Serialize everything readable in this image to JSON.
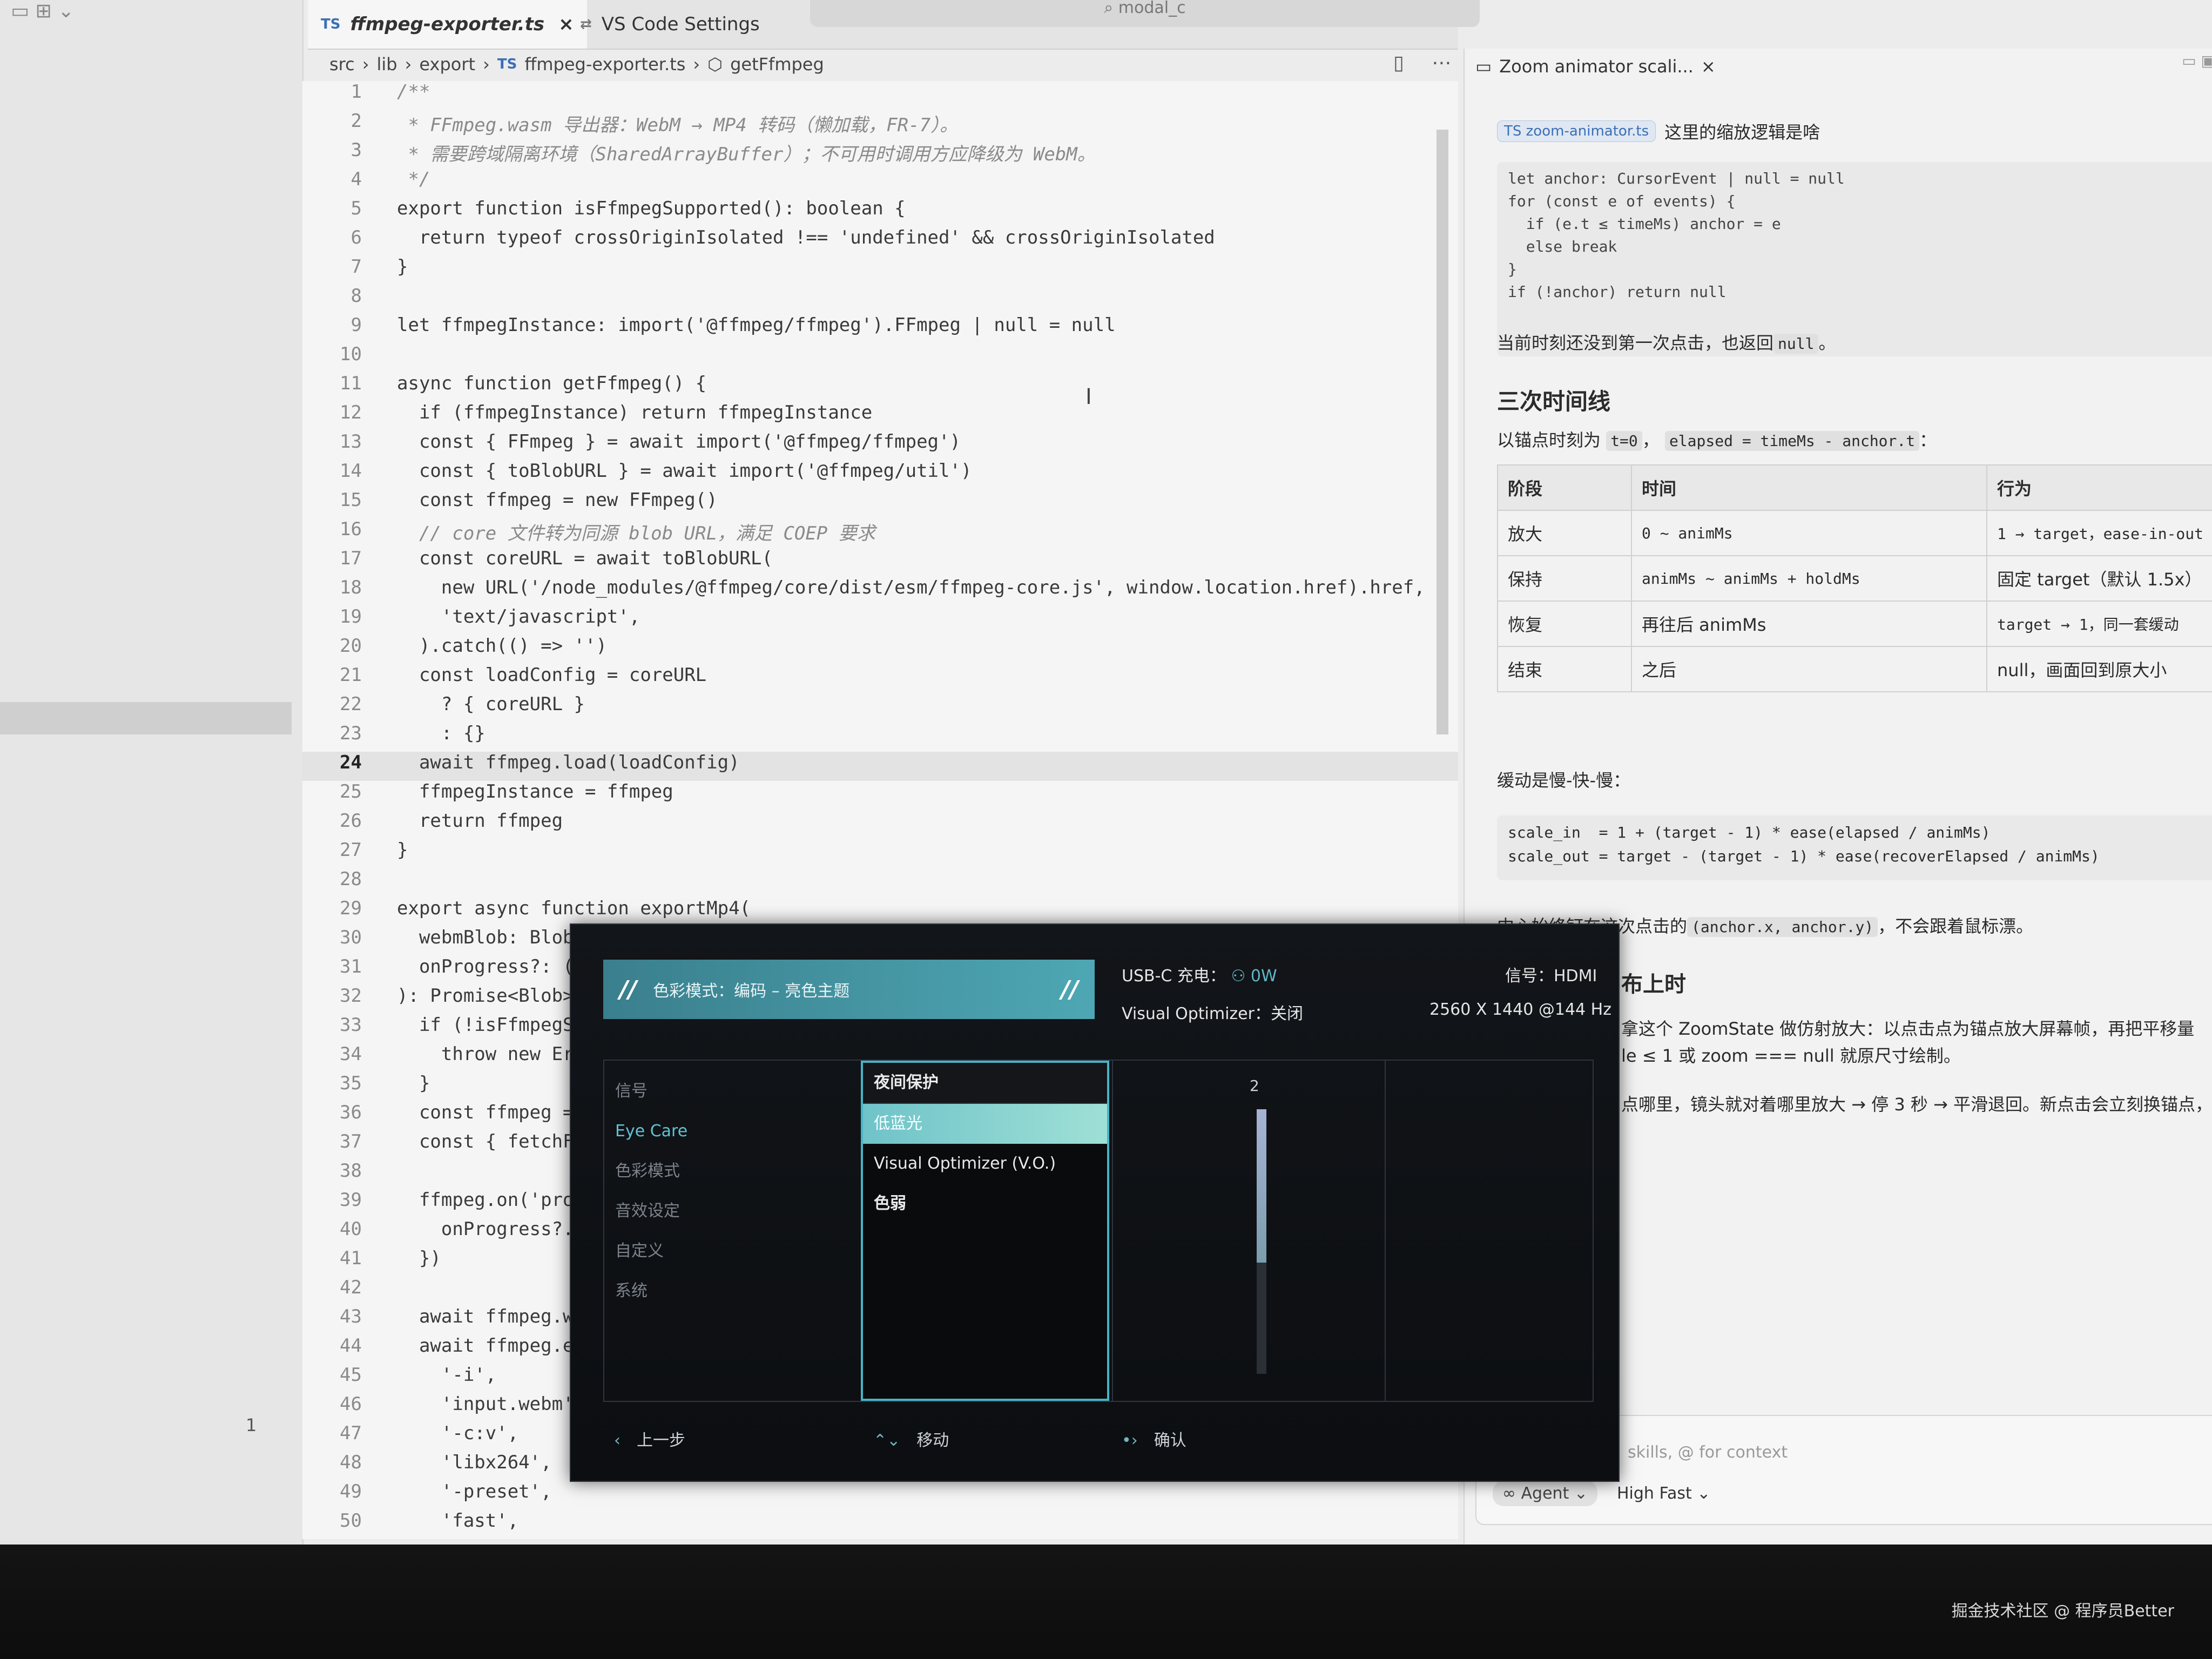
{
  "editor": {
    "tabs": [
      {
        "lang": "TS",
        "label": "ffmpeg-exporter.ts",
        "close": "×"
      },
      {
        "lang": "⇄",
        "label": "VS Code Settings"
      }
    ],
    "search": "modal_c",
    "breadcrumb": [
      "src",
      "lib",
      "export",
      "ffmpeg-exporter.ts",
      "getFfmpeg"
    ],
    "breadcrumb_lang": "TS",
    "tools": "▯ ⋯",
    "gutter_marker": "1",
    "lines": [
      {
        "n": "1",
        "t": "/**"
      },
      {
        "n": "2",
        "t": " * FFmpeg.wasm 导出器：WebM → MP4 转码（懒加载，FR-7）。"
      },
      {
        "n": "3",
        "t": " * 需要跨域隔离环境（SharedArrayBuffer）；不可用时调用方应降级为 WebM。"
      },
      {
        "n": "4",
        "t": " */"
      },
      {
        "n": "5",
        "t": "export function isFfmpegSupported(): boolean {"
      },
      {
        "n": "6",
        "t": "  return typeof crossOriginIsolated !== 'undefined' && crossOriginIsolated"
      },
      {
        "n": "7",
        "t": "}"
      },
      {
        "n": "8",
        "t": ""
      },
      {
        "n": "9",
        "t": "let ffmpegInstance: import('@ffmpeg/ffmpeg').FFmpeg | null = null"
      },
      {
        "n": "10",
        "t": ""
      },
      {
        "n": "11",
        "t": "async function getFfmpeg() {"
      },
      {
        "n": "12",
        "t": "  if (ffmpegInstance) return ffmpegInstance"
      },
      {
        "n": "13",
        "t": "  const { FFmpeg } = await import('@ffmpeg/ffmpeg')"
      },
      {
        "n": "14",
        "t": "  const { toBlobURL } = await import('@ffmpeg/util')"
      },
      {
        "n": "15",
        "t": "  const ffmpeg = new FFmpeg()"
      },
      {
        "n": "16",
        "t": "  // core 文件转为同源 blob URL，满足 COEP 要求"
      },
      {
        "n": "17",
        "t": "  const coreURL = await toBlobURL("
      },
      {
        "n": "18",
        "t": "    new URL('/node_modules/@ffmpeg/core/dist/esm/ffmpeg-core.js', window.location.href).href,"
      },
      {
        "n": "19",
        "t": "    'text/javascript',"
      },
      {
        "n": "20",
        "t": "  ).catch(() => '')"
      },
      {
        "n": "21",
        "t": "  const loadConfig = coreURL"
      },
      {
        "n": "22",
        "t": "    ? { coreURL }"
      },
      {
        "n": "23",
        "t": "    : {}"
      },
      {
        "n": "24",
        "t": "  await ffmpeg.load(loadConfig)"
      },
      {
        "n": "25",
        "t": "  ffmpegInstance = ffmpeg"
      },
      {
        "n": "26",
        "t": "  return ffmpeg"
      },
      {
        "n": "27",
        "t": "}"
      },
      {
        "n": "28",
        "t": ""
      },
      {
        "n": "29",
        "t": "export async function exportMp4("
      },
      {
        "n": "30",
        "t": "  webmBlob: Blob"
      },
      {
        "n": "31",
        "t": "  onProgress?: ("
      },
      {
        "n": "32",
        "t": "): Promise<Blob>"
      },
      {
        "n": "33",
        "t": "  if (!isFfmpegS"
      },
      {
        "n": "34",
        "t": "    throw new Er"
      },
      {
        "n": "35",
        "t": "  }"
      },
      {
        "n": "36",
        "t": "  const ffmpeg ="
      },
      {
        "n": "37",
        "t": "  const { fetchF"
      },
      {
        "n": "38",
        "t": ""
      },
      {
        "n": "39",
        "t": "  ffmpeg.on('pro"
      },
      {
        "n": "40",
        "t": "    onProgress?."
      },
      {
        "n": "41",
        "t": "  })"
      },
      {
        "n": "42",
        "t": ""
      },
      {
        "n": "43",
        "t": "  await ffmpeg.w"
      },
      {
        "n": "44",
        "t": "  await ffmpeg.e"
      },
      {
        "n": "45",
        "t": "    '-i',"
      },
      {
        "n": "46",
        "t": "    'input.webm'"
      },
      {
        "n": "47",
        "t": "    '-c:v',"
      },
      {
        "n": "48",
        "t": "    'libx264',"
      },
      {
        "n": "49",
        "t": "    '-preset',"
      },
      {
        "n": "50",
        "t": "    'fast',"
      }
    ]
  },
  "chat": {
    "tab_label": "Zoom animator scali...",
    "tab_close": "×",
    "query_chip": "TS zoom-animator.ts",
    "query_text": "这里的缩放逻辑是啥",
    "code_snippet": "let anchor: CursorEvent | null = null\nfor (const e of events) {\n  if (e.t ≤ timeMs) anchor = e\n  else break\n}\nif (!anchor) return null",
    "p1_pre": "当前时刻还没到第一次点击，也返回",
    "p1_code": "null",
    "p1_post": "。",
    "heading": "三次时间线",
    "p2_pre": "以锚点时刻为",
    "p2_code1": "t=0",
    "p2_mid": "，",
    "p2_code2": "elapsed = timeMs - anchor.t",
    "p2_post": "：",
    "table_headers": [
      "阶段",
      "时间",
      "行为"
    ],
    "table_rows": [
      [
        "放大",
        "0 ~ animMs",
        "1 → target，ease-in-out"
      ],
      [
        "保持",
        "animMs ~ animMs + holdMs",
        "固定 target（默认 1.5x）"
      ],
      [
        "恢复",
        "再往后 animMs",
        "target → 1，同一套缓动"
      ],
      [
        "结束",
        "之后",
        "null，画面回到原大小"
      ]
    ],
    "p3": "缓动是慢-快-慢：",
    "formula": "scale_in  = 1 + (target - 1) * ease(elapsed / animMs)\nscale_out = target - (target - 1) * ease(recoverElapsed / animMs)",
    "p4_pre": "中心始终钉在这次点击的",
    "p4_code": "(anchor.x, anchor.y)",
    "p4_post": "，不会跟着鼠标漂。",
    "p5_heading": "布上时",
    "p5_line1": "拿这个 ZoomState 做仿射放大：以点击点为锚点放大屏幕帧，再把平移量",
    "p5_line2": "le ≤ 1 或 zoom === null 就原尺寸绘制。",
    "p6": "点哪里，镜头就对着哪里放大 → 停 3 秒 → 平滑退回。新点击会立刻换锚点，",
    "input_placeholder": "skills, @ for context",
    "agent": "∞ Agent ⌄",
    "model": "High Fast ⌄"
  },
  "osd": {
    "mode_label": "色彩模式：编码 – 亮色主题",
    "mode_slash": "//",
    "usb": "USB-C 充电：",
    "usb_value": "0W",
    "optimizer": "Visual Optimizer：关闭",
    "signal": "信号：HDMI",
    "resolution": "2560 X 1440 @144 Hz",
    "menu": [
      "信号",
      "Eye Care",
      "色彩模式",
      "音效设定",
      "自定义",
      "系统"
    ],
    "menu_selected": 1,
    "submenu": [
      "夜间保护",
      "低蓝光",
      "Visual Optimizer (V.O.)",
      "色弱"
    ],
    "slider_value": "2",
    "slider_level": 0.58,
    "footer": {
      "back_icon": "‹",
      "back": "上一步",
      "move_icon": "⌃⌄",
      "move": "移动",
      "ok_icon": "•›",
      "ok": "确认"
    }
  },
  "watermark": "掘金技术社区 @ 程序员Better"
}
